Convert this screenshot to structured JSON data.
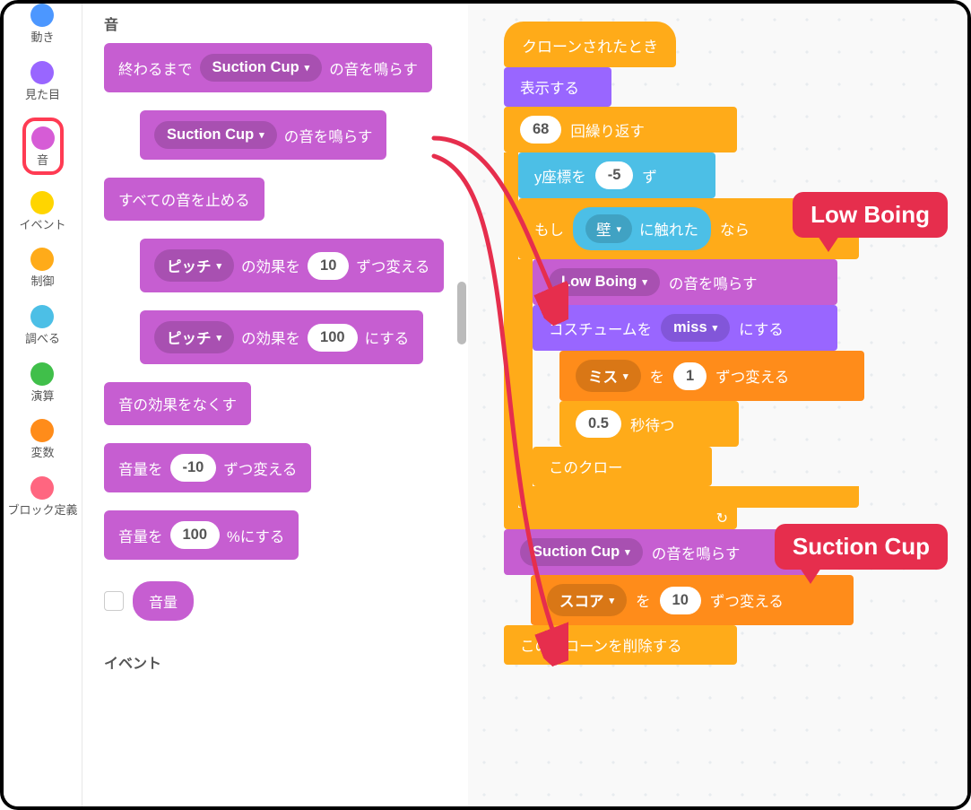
{
  "categories": [
    {
      "label": "動き",
      "color": "#4c97ff"
    },
    {
      "label": "見た目",
      "color": "#9966ff"
    },
    {
      "label": "音",
      "color": "#d65cd6"
    },
    {
      "label": "イベント",
      "color": "#ffd500"
    },
    {
      "label": "制御",
      "color": "#ffab19"
    },
    {
      "label": "調べる",
      "color": "#4cbfe6"
    },
    {
      "label": "演算",
      "color": "#40bf4a"
    },
    {
      "label": "変数",
      "color": "#ff8c1a"
    },
    {
      "label": "ブロック定義",
      "color": "#ff6680"
    }
  ],
  "palette_heading_top": "音",
  "palette_heading_bottom": "イベント",
  "palette": {
    "play_until_done_pre": "終わるまで",
    "play_until_done_sound": "Suction Cup",
    "play_until_done_post": "の音を鳴らす",
    "play_sound": "Suction Cup",
    "play_label": "の音を鳴らす",
    "stop_all": "すべての音を止める",
    "effect_label": "ピッチ",
    "effect_change_mid": "の効果を",
    "effect_change_val": "10",
    "effect_change_post": "ずつ変える",
    "effect_set_val": "100",
    "effect_set_post": "にする",
    "clear_effects": "音の効果をなくす",
    "vol_change_pre": "音量を",
    "vol_change_val": "-10",
    "vol_change_post": "ずつ変える",
    "vol_set_val": "100",
    "vol_set_post": "%にする",
    "vol_reporter": "音量"
  },
  "script": {
    "hat": "クローンされたとき",
    "show": "表示する",
    "repeat_count": "68",
    "repeat_label": "回繰り返す",
    "changey_pre": "y座標を",
    "changey_val": "-5",
    "changey_post": "ず",
    "if_pre": "もし",
    "touch_label": "壁",
    "touch_post": "に触れた",
    "if_post": "なら",
    "play_low_sound": "Low Boing",
    "play_low_post": "の音を鳴らす",
    "costume_pre": "コスチュームを",
    "costume_val": "miss",
    "costume_post": "にする",
    "var_miss": "ミス",
    "var_mid": "を",
    "var_miss_val": "1",
    "var_post": "ずつ変える",
    "wait_val": "0.5",
    "wait_post": "秒待つ",
    "delete1": "このクロー",
    "play_suc_sound": "Suction Cup",
    "play_suc_post": "の音を鳴らす",
    "var_score": "スコア",
    "var_score_val": "10",
    "delete2": "このクローンを削除する"
  },
  "callouts": {
    "low": "Low Boing",
    "suc": "Suction Cup"
  }
}
